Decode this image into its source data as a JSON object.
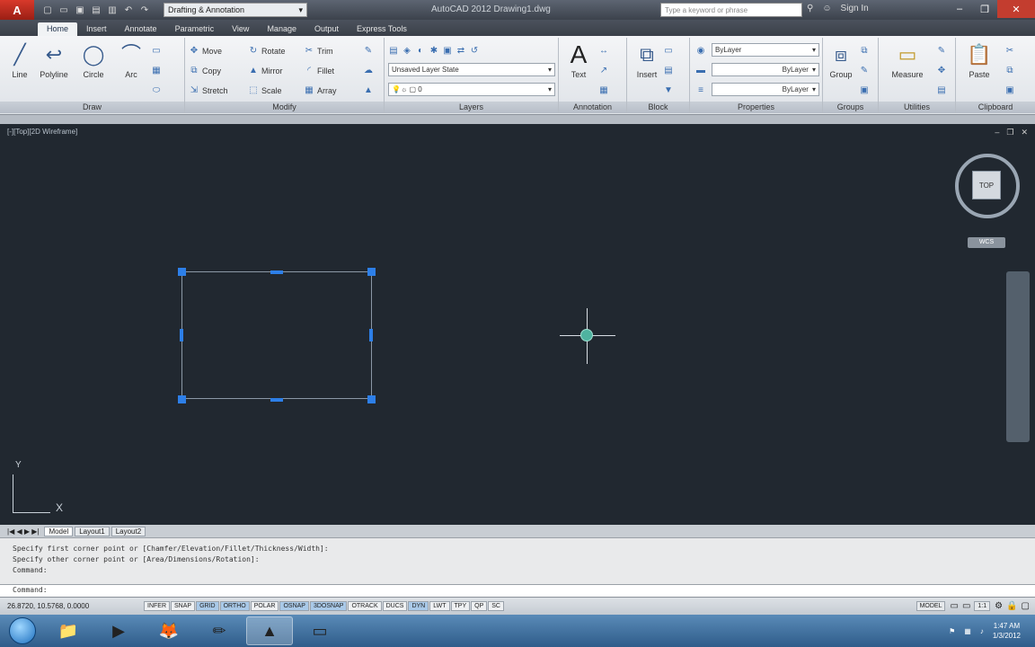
{
  "titlebar": {
    "app_icon": "autocad-a-icon",
    "workspace": "Drafting & Annotation",
    "doc_title": "AutoCAD 2012  Drawing1.dwg",
    "search_placeholder": "Type a keyword or phrase",
    "sign_in": "Sign In"
  },
  "tabs": [
    "Home",
    "Insert",
    "Annotate",
    "Parametric",
    "View",
    "Manage",
    "Output",
    "Express Tools"
  ],
  "ribbon": {
    "draw": {
      "title": "Draw",
      "line": "Line",
      "polyline": "Polyline",
      "circle": "Circle",
      "arc": "Arc"
    },
    "modify": {
      "title": "Modify",
      "move": "Move",
      "rotate": "Rotate",
      "trim": "Trim",
      "copy": "Copy",
      "mirror": "Mirror",
      "fillet": "Fillet",
      "stretch": "Stretch",
      "scale": "Scale",
      "array": "Array"
    },
    "layers": {
      "title": "Layers",
      "state": "Unsaved Layer State",
      "current": "0"
    },
    "annotation": {
      "title": "Annotation",
      "text": "Text"
    },
    "block": {
      "title": "Block",
      "insert": "Insert"
    },
    "properties": {
      "title": "Properties",
      "color": "ByLayer",
      "linetype": "ByLayer",
      "lineweight": "ByLayer"
    },
    "groups": {
      "title": "Groups",
      "group": "Group"
    },
    "utilities": {
      "title": "Utilities",
      "measure": "Measure"
    },
    "clipboard": {
      "title": "Clipboard",
      "paste": "Paste"
    }
  },
  "viewport": {
    "label": "[-][Top][2D Wireframe]",
    "viewcube_face": "TOP",
    "wcs": "WCS",
    "ucs_x": "X",
    "ucs_y": "Y"
  },
  "layout_tabs": [
    "Model",
    "Layout1",
    "Layout2"
  ],
  "command": {
    "history": [
      "Specify first corner point or [Chamfer/Elevation/Fillet/Thickness/Width]:",
      "Specify other corner point or [Area/Dimensions/Rotation]:",
      "Command:"
    ],
    "prompt": "Command:"
  },
  "statusbar": {
    "coords": "26.8720, 10.5768, 0.0000",
    "toggles": [
      "INFER",
      "SNAP",
      "GRID",
      "ORTHO",
      "POLAR",
      "OSNAP",
      "3DOSNAP",
      "OTRACK",
      "DUCS",
      "DYN",
      "LWT",
      "TPY",
      "QP",
      "SC"
    ],
    "model": "MODEL",
    "scale": "1:1"
  },
  "taskbar": {
    "time": "1:47 AM",
    "date": "1/3/2012"
  }
}
